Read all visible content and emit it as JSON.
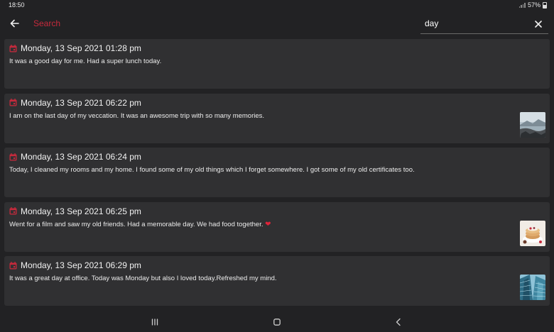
{
  "status": {
    "time": "18:50",
    "battery": "57%"
  },
  "appbar": {
    "title": "Search"
  },
  "search": {
    "value": "day"
  },
  "entries": [
    {
      "date": "Monday, 13 Sep 2021 01:28 pm",
      "text": "It was a good day for me. Had a super lunch today.",
      "thumbnail": null
    },
    {
      "date": "Monday, 13 Sep 2021 06:22 pm",
      "text": "I am on the last day of my veccation. It was an awesome trip with so many memories.",
      "thumbnail": "landscape-photo"
    },
    {
      "date": "Monday, 13 Sep 2021 06:24 pm",
      "text": "Today, I cleaned my rooms and my home. I found some of my old things which I forget somewhere. I got some of my old certificates too.",
      "thumbnail": null
    },
    {
      "date": "Monday, 13 Sep 2021 06:25 pm",
      "text": "Went for a film and saw my old friends. Had a memorable day.  We had food together.",
      "emoji": "❤",
      "thumbnail": "food-photo"
    },
    {
      "date": "Monday, 13 Sep 2021 06:29 pm",
      "text": "It was a great day at office. Today was Monday but also I loved today.Refreshed my mind.",
      "thumbnail": "building-photo"
    }
  ],
  "colors": {
    "accent": "#c62a3c",
    "background": "#222224",
    "card": "#303032",
    "text": "#ececec"
  },
  "icons": {
    "back": "arrow-left-icon",
    "clear": "close-icon",
    "calendar": "calendar-icon",
    "nav_recents": "recents-icon",
    "nav_home": "home-icon",
    "nav_back": "chevron-left-icon"
  }
}
